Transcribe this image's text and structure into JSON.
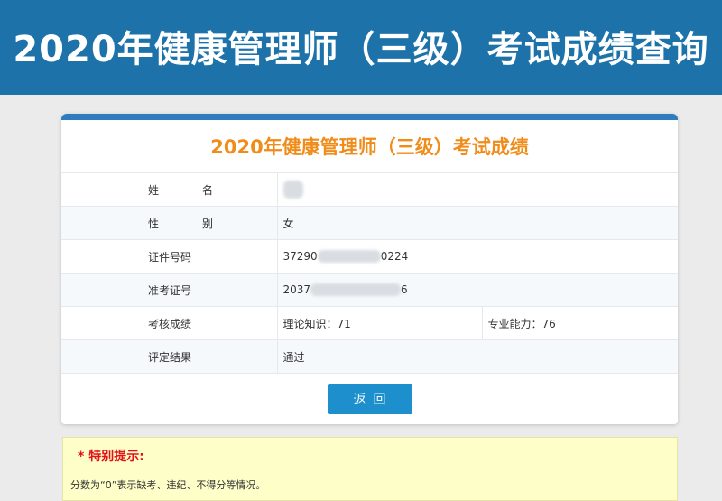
{
  "header": {
    "title": "2020年健康管理师（三级）考试成绩查询"
  },
  "card": {
    "title": "2020年健康管理师（三级）考试成绩",
    "rows": [
      {
        "label": "姓　名",
        "value": ""
      },
      {
        "label": "性　别",
        "value": "女"
      },
      {
        "label": "证件号码",
        "value_start": "37290",
        "value_end": "0224"
      },
      {
        "label": "准考证号",
        "value_start": "2037",
        "value_end": "6"
      },
      {
        "label": "考核成绩",
        "theory": "理论知识：71",
        "skill": "专业能力：76"
      },
      {
        "label": "评定结果",
        "value": "通过"
      }
    ],
    "back_label": "返回"
  },
  "notice": {
    "title": "* 特别提示:",
    "text": "分数为“0”表示缺考、违纪、不得分等情况。"
  },
  "colors": {
    "banner": "#1d73a9",
    "card_title": "#f08c1a",
    "button": "#1d8fcc",
    "notice_title": "#e3101a",
    "notice_bg": "#fefec8"
  }
}
